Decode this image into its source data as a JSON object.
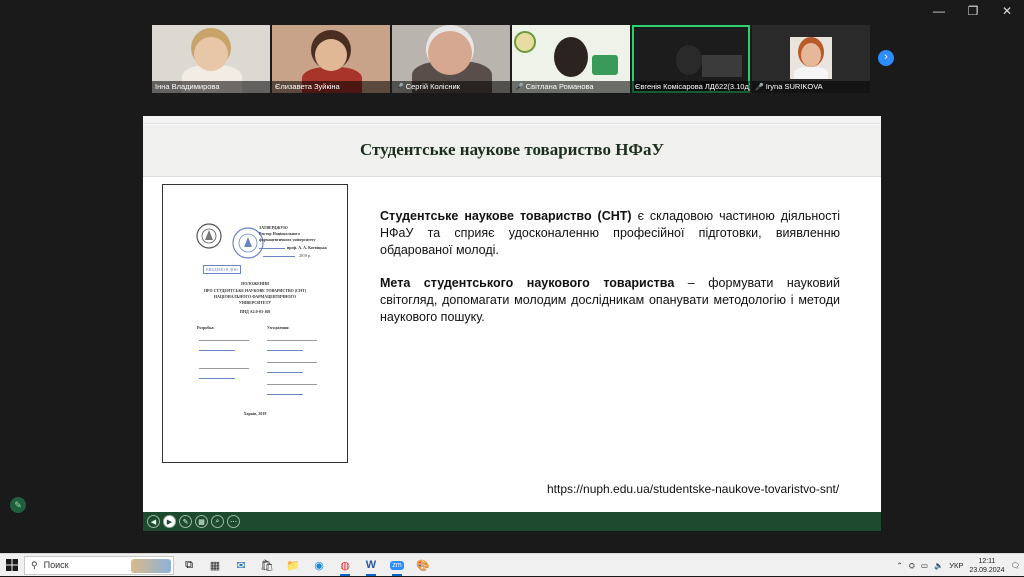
{
  "participants": [
    {
      "name": "Інна Владимирова",
      "muted": false
    },
    {
      "name": "Єлизавета Зуйкіна",
      "muted": false
    },
    {
      "name": "Сергій Колісник",
      "muted": true
    },
    {
      "name": "Світлана Романова",
      "muted": true
    },
    {
      "name": "Євгенія Комісарова ЛД622(3.10д)",
      "muted": false
    },
    {
      "name": "Iryna SURIKOVA",
      "muted": true
    }
  ],
  "next_icon": "chevron-right-icon",
  "slide": {
    "title": "Студентське наукове товариство НФаУ",
    "para1_bold": "Студентське наукове товариство (СНТ)",
    "para1_rest": " є складовою частиною діяльності НФаУ та сприяє удосконаленню професійної підготовки, виявленню обдарованої молоді.",
    "para2_bold": "Мета студентського наукового товариства",
    "para2_rest": " – формувати науковий світогляд, допомагати молодим дослідникам опанувати методологію і методи наукового пошуку.",
    "url": "https://nuph.edu.ua/studentske-naukove-tovaristvo-snt/",
    "doc": {
      "approve": "ЗАТВЕРДЖУЮ",
      "approve_l1": "Ректор Національного",
      "approve_l2": "фармацевтичного університету",
      "approve_l3": "проф. А. А. Котвіцька",
      "approve_l4": "2019 р.",
      "stamp": "ВВЕДЕНО В ДІЮ",
      "h1": "ПОЛОЖЕННЯ",
      "h2": "ПРО СТУДЕНТСЬКЕ НАУКОВЕ ТОВАРИСТВО (СНТ)",
      "h3": "НАЦІОНАЛЬНОГО ФАРМАЦЕВТИЧНОГО",
      "h4": "УНІВЕРСИТЕТУ",
      "code": "ПНД А2.0-03-168",
      "left_head": "Розробка:",
      "right_head": "Узгодження:",
      "city": "Харків, 2019"
    }
  },
  "taskbar": {
    "search_placeholder": "Поиск",
    "lang": "УКР",
    "time": "12:11",
    "date": "23.09.2024"
  },
  "colors": {
    "ctrl_bar": "#1e4b30",
    "active_speaker": "#2bd16f",
    "zoom_blue": "#2d8cff"
  }
}
